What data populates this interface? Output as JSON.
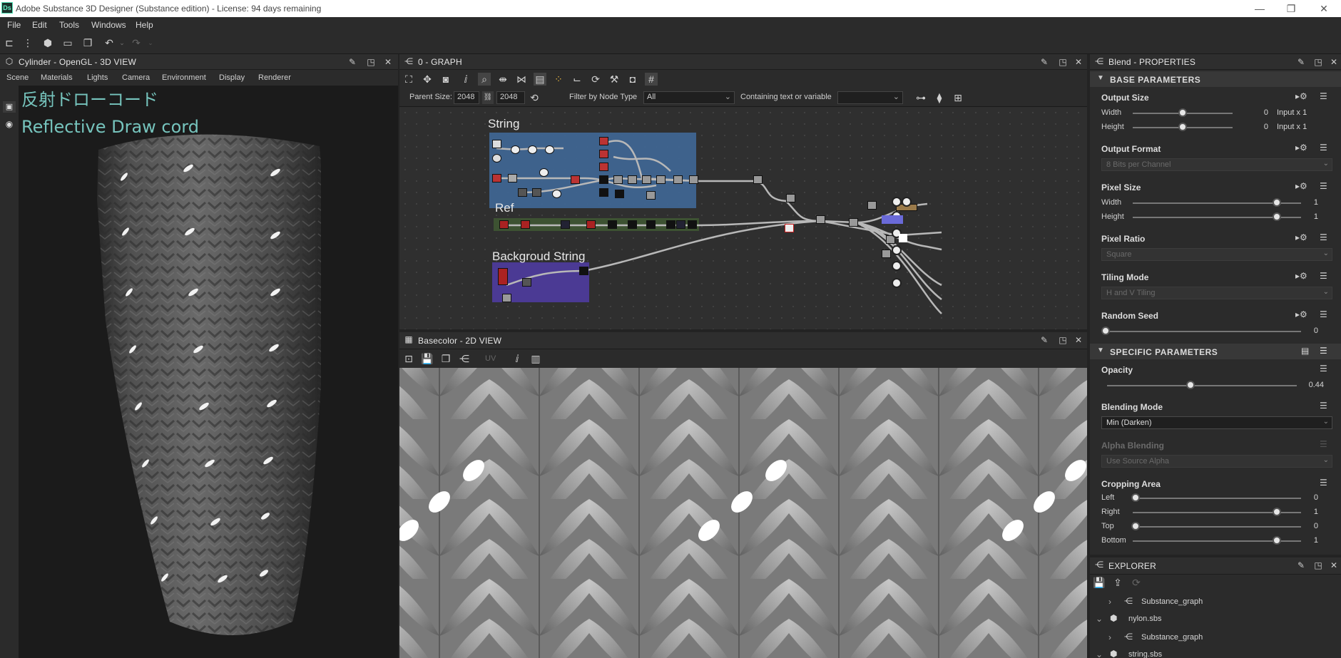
{
  "window": {
    "title": "Adobe Substance 3D Designer (Substance edition) - License: 94 days remaining",
    "app_icon_text": "Ds",
    "controls": [
      "—",
      "❐",
      "✕"
    ]
  },
  "menu": [
    "File",
    "Edit",
    "Tools",
    "Windows",
    "Help"
  ],
  "view3d": {
    "title": "Cylinder - OpenGL - 3D VIEW",
    "tabs": [
      "Scene",
      "Materials",
      "Lights",
      "Camera",
      "Environment",
      "Display",
      "Renderer"
    ],
    "overlay_jp": "反射ドローコード",
    "overlay_en": "Reflective Draw cord"
  },
  "graph": {
    "title": "0 - GRAPH",
    "parent_size_label": "Parent Size:",
    "parent_size_w": "2048",
    "parent_size_h": "2048",
    "filter_label": "Filter by Node Type",
    "filter_value": "All",
    "containing_label": "Containing text or variable",
    "containing_value": "",
    "frames": {
      "string": "String",
      "ref": "Ref",
      "background": "Backgroud String"
    }
  },
  "view2d": {
    "title": "Basecolor - 2D VIEW",
    "uv_label": "UV"
  },
  "properties": {
    "title": "Blend - PROPERTIES",
    "base_section": "BASE PARAMETERS",
    "specific_section": "SPECIFIC PARAMETERS",
    "output_size": {
      "label": "Output Size",
      "width_label": "Width",
      "height_label": "Height",
      "width_value": "0",
      "height_value": "0",
      "width_mode": "Input x 1",
      "height_mode": "Input x 1",
      "width_pos": 0.5,
      "height_pos": 0.5
    },
    "output_format": {
      "label": "Output Format",
      "value": "8 Bits per Channel"
    },
    "pixel_size": {
      "label": "Pixel Size",
      "width_label": "Width",
      "height_label": "Height",
      "width_value": "1",
      "height_value": "1"
    },
    "pixel_ratio": {
      "label": "Pixel Ratio",
      "value": "Square"
    },
    "tiling_mode": {
      "label": "Tiling Mode",
      "value": "H and V Tiling"
    },
    "random_seed": {
      "label": "Random Seed",
      "value": "0"
    },
    "opacity": {
      "label": "Opacity",
      "value": "0.44",
      "pos": 0.44
    },
    "blending_mode": {
      "label": "Blending Mode",
      "value": "Min (Darken)"
    },
    "alpha_blending": {
      "label": "Alpha Blending",
      "value": "Use Source Alpha"
    },
    "cropping": {
      "label": "Cropping Area",
      "left_label": "Left",
      "left_value": "0",
      "right_label": "Right",
      "right_value": "1",
      "top_label": "Top",
      "top_value": "0",
      "bottom_label": "Bottom",
      "bottom_value": "1"
    }
  },
  "explorer": {
    "title": "EXPLORER",
    "rows": [
      {
        "label": "Substance_graph",
        "kind": "graph"
      },
      {
        "label": "nylon.sbs",
        "kind": "package"
      },
      {
        "label": "Substance_graph",
        "kind": "graph"
      },
      {
        "label": "string.sbs",
        "kind": "package"
      }
    ]
  },
  "colors": {
    "frame_string": "#3f6591",
    "frame_ref": "#3d5232",
    "frame_background": "#4b3a94",
    "overlay_text": "#76c4bd"
  }
}
